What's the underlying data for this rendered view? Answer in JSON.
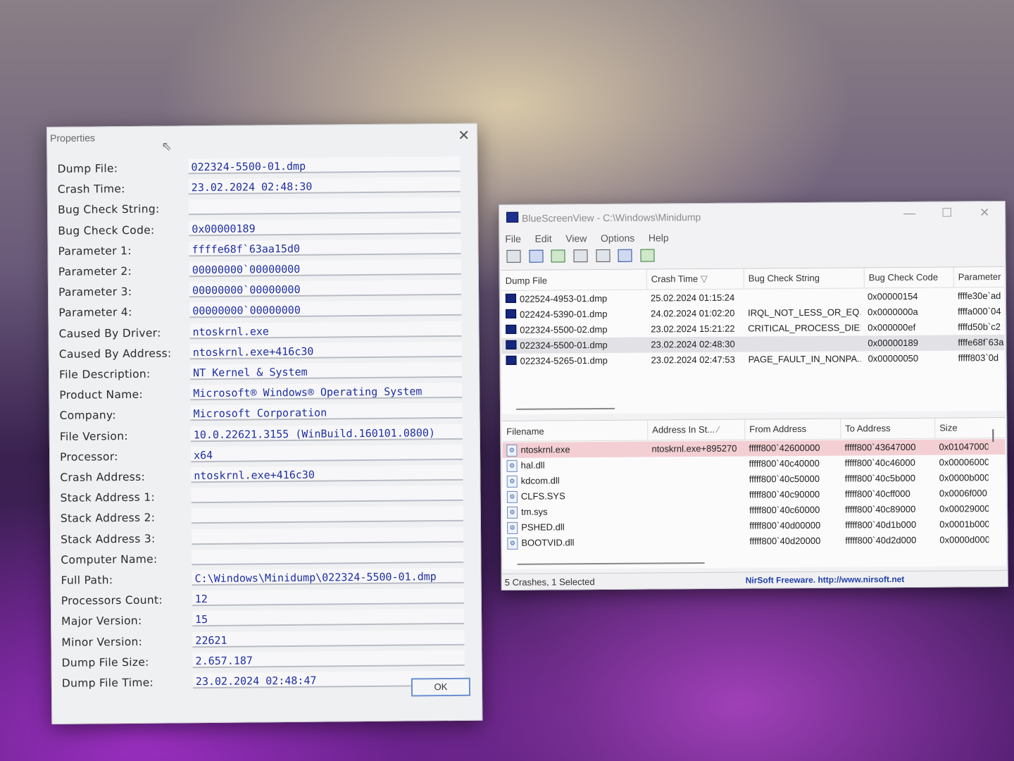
{
  "properties": {
    "title": "Properties",
    "ok_label": "OK",
    "fields": [
      {
        "label": "Dump File:",
        "value": "022324-5500-01.dmp"
      },
      {
        "label": "Crash Time:",
        "value": "23.02.2024 02:48:30"
      },
      {
        "label": "Bug Check String:",
        "value": ""
      },
      {
        "label": "Bug Check Code:",
        "value": "0x00000189"
      },
      {
        "label": "Parameter 1:",
        "value": "ffffe68f`63aa15d0"
      },
      {
        "label": "Parameter 2:",
        "value": "00000000`00000000"
      },
      {
        "label": "Parameter 3:",
        "value": "00000000`00000000"
      },
      {
        "label": "Parameter 4:",
        "value": "00000000`00000000"
      },
      {
        "label": "Caused By Driver:",
        "value": "ntoskrnl.exe"
      },
      {
        "label": "Caused By Address:",
        "value": "ntoskrnl.exe+416c30"
      },
      {
        "label": "File Description:",
        "value": "NT Kernel & System"
      },
      {
        "label": "Product Name:",
        "value": "Microsoft® Windows® Operating System"
      },
      {
        "label": "Company:",
        "value": "Microsoft Corporation"
      },
      {
        "label": "File Version:",
        "value": "10.0.22621.3155 (WinBuild.160101.0800)"
      },
      {
        "label": "Processor:",
        "value": "x64"
      },
      {
        "label": "Crash Address:",
        "value": "ntoskrnl.exe+416c30"
      },
      {
        "label": "Stack Address 1:",
        "value": ""
      },
      {
        "label": "Stack Address 2:",
        "value": ""
      },
      {
        "label": "Stack Address 3:",
        "value": ""
      },
      {
        "label": "Computer Name:",
        "value": ""
      },
      {
        "label": "Full Path:",
        "value": "C:\\Windows\\Minidump\\022324-5500-01.dmp"
      },
      {
        "label": "Processors Count:",
        "value": "12"
      },
      {
        "label": "Major Version:",
        "value": "15"
      },
      {
        "label": "Minor Version:",
        "value": "22621"
      },
      {
        "label": "Dump File Size:",
        "value": "2.657.187"
      },
      {
        "label": "Dump File Time:",
        "value": "23.02.2024 02:48:47"
      }
    ]
  },
  "bsv": {
    "title": "BlueScreenView  -  C:\\Windows\\Minidump",
    "menu": [
      "File",
      "Edit",
      "View",
      "Options",
      "Help"
    ],
    "dumps": {
      "columns": [
        "Dump File",
        "Crash Time",
        "Bug Check String",
        "Bug Check Code",
        "Parameter"
      ],
      "rows": [
        {
          "file": "022524-4953-01.dmp",
          "time": "25.02.2024 01:15:24",
          "str": "",
          "code": "0x00000154",
          "param": "ffffe30e`ad"
        },
        {
          "file": "022424-5390-01.dmp",
          "time": "24.02.2024 01:02:20",
          "str": "IRQL_NOT_LESS_OR_EQ...",
          "code": "0x0000000a",
          "param": "ffffa000`04"
        },
        {
          "file": "022324-5500-02.dmp",
          "time": "23.02.2024 15:21:22",
          "str": "CRITICAL_PROCESS_DIED",
          "code": "0x000000ef",
          "param": "ffffd50b`c2"
        },
        {
          "file": "022324-5500-01.dmp",
          "time": "23.02.2024 02:48:30",
          "str": "",
          "code": "0x00000189",
          "param": "ffffe68f`63a"
        },
        {
          "file": "022324-5265-01.dmp",
          "time": "23.02.2024 02:47:53",
          "str": "PAGE_FAULT_IN_NONPA...",
          "code": "0x00000050",
          "param": "fffff803`0d"
        }
      ]
    },
    "drivers": {
      "columns": [
        "Filename",
        "Address In St...",
        "From Address",
        "To Address",
        "Size"
      ],
      "rows": [
        {
          "name": "ntoskrnl.exe",
          "addr": "ntoskrnl.exe+895270",
          "from": "fffff800`42600000",
          "to": "fffff800`43647000",
          "size": "0x01047000"
        },
        {
          "name": "hal.dll",
          "addr": "",
          "from": "fffff800`40c40000",
          "to": "fffff800`40c46000",
          "size": "0x00006000"
        },
        {
          "name": "kdcom.dll",
          "addr": "",
          "from": "fffff800`40c50000",
          "to": "fffff800`40c5b000",
          "size": "0x0000b000"
        },
        {
          "name": "CLFS.SYS",
          "addr": "",
          "from": "fffff800`40c90000",
          "to": "fffff800`40cff000",
          "size": "0x0006f000"
        },
        {
          "name": "tm.sys",
          "addr": "",
          "from": "fffff800`40c60000",
          "to": "fffff800`40c89000",
          "size": "0x00029000"
        },
        {
          "name": "PSHED.dll",
          "addr": "",
          "from": "fffff800`40d00000",
          "to": "fffff800`40d1b000",
          "size": "0x0001b000"
        },
        {
          "name": "BOOTVID.dll",
          "addr": "",
          "from": "fffff800`40d20000",
          "to": "fffff800`40d2d000",
          "size": "0x0000d000"
        }
      ]
    },
    "status_left": "5 Crashes, 1 Selected",
    "status_right": "NirSoft Freeware.  http://www.nirsoft.net"
  }
}
